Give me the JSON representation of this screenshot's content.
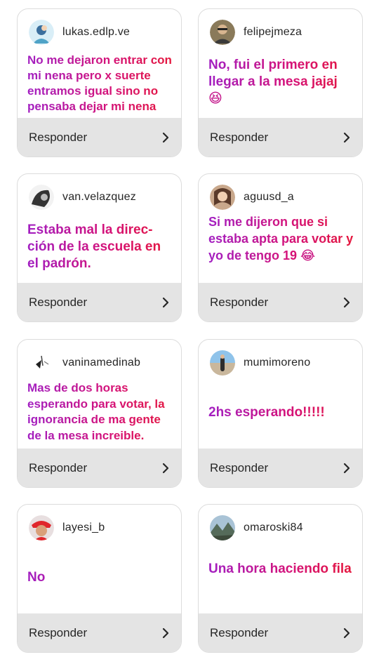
{
  "reply_label": "Responder",
  "cards": [
    {
      "username": "lukas.edlp.ve",
      "message": "No me dejaron entrar con mi nena pero x suerte entramos igual sino no pensaba dejar mi nena",
      "emoji": ""
    },
    {
      "username": "felipejmeza",
      "message": "No, fui el primero en llegar a la mesa jajaj",
      "emoji": "😆"
    },
    {
      "username": "van.velazquez",
      "message": "Estaba mal la direc-ción de la escuela en el padrón.",
      "emoji": ""
    },
    {
      "username": "aguusd_a",
      "message": "Si me dijeron que si estaba apta para votar y yo de tengo 19",
      "emoji": "😂"
    },
    {
      "username": "vaninamedinab",
      "message": "Mas de dos horas esperando para votar, la ignorancia de ma gente de la mesa increible.",
      "emoji": ""
    },
    {
      "username": "mumimoreno",
      "message": "2hs esperando!!!!!",
      "emoji": ""
    },
    {
      "username": "layesi_b",
      "message": "No",
      "emoji": ""
    },
    {
      "username": "omaroski84",
      "message": "Una hora haciendo fila",
      "emoji": ""
    }
  ]
}
